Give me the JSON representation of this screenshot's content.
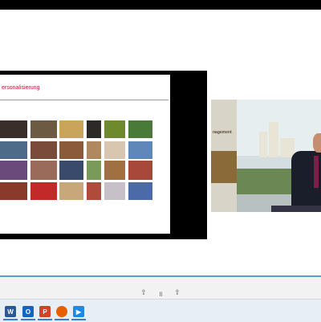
{
  "slide": {
    "title": "ersonalisierung",
    "thumbnails": [
      {
        "color": "#3a2e2a"
      },
      {
        "color": "#6c5a42"
      },
      {
        "color": "#c9a45a"
      },
      {
        "color": "#2c2a26"
      },
      {
        "color": "#6e8a2c"
      },
      {
        "color": "#4a7a38"
      },
      {
        "color": "#4e6b8a"
      },
      {
        "color": "#7a4a3a"
      },
      {
        "color": "#8a5a3a"
      },
      {
        "color": "#b08860"
      },
      {
        "color": "#d8c6b0"
      },
      {
        "color": "#5f88b8"
      },
      {
        "color": "#6a4a7a"
      },
      {
        "color": "#9a6a5a"
      },
      {
        "color": "#3a4a6a"
      },
      {
        "color": "#7a9a5a"
      },
      {
        "color": "#a07040"
      },
      {
        "color": "#a8483a"
      },
      {
        "color": "#8a3a2a"
      },
      {
        "color": "#c22a2a"
      },
      {
        "color": "#c8a87a"
      },
      {
        "color": "#b04a3a"
      },
      {
        "color": "#c8c0c8"
      },
      {
        "color": "#4a6aa8"
      }
    ]
  },
  "video": {
    "sign_text": "nagement"
  },
  "player": {
    "prev_label": "⇧",
    "pause_label": "॥",
    "next_label": "⇪",
    "progress": 1.0,
    "accent": "#55a4d0"
  },
  "taskbar": {
    "icons": [
      {
        "name": "word-icon",
        "label": "W",
        "color": "#2b5797"
      },
      {
        "name": "outlook-icon",
        "label": "O",
        "color": "#1565c0"
      },
      {
        "name": "powerpoint-icon",
        "label": "P",
        "color": "#d04423"
      },
      {
        "name": "firefox-icon",
        "label": "",
        "color": "#e66000"
      },
      {
        "name": "media-player-icon",
        "label": "▶",
        "color": "#1e88e5"
      }
    ]
  }
}
